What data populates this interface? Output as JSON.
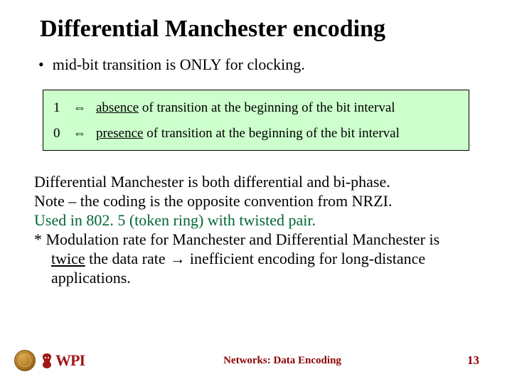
{
  "title": "Differential Manchester encoding",
  "bullet": "mid-bit transition is ONLY for clocking.",
  "rules": [
    {
      "bit": "1",
      "arrow": "⇔",
      "keyword": "absence",
      "rest": " of transition at the beginning of the bit interval"
    },
    {
      "bit": "0",
      "arrow": "⇔",
      "keyword": "presence",
      "rest": " of transition at the beginning of the bit interval"
    }
  ],
  "body": {
    "line1": "Differential Manchester is both differential and bi-phase.",
    "line2": "Note – the coding is the opposite convention from NRZI.",
    "line3": "Used in 802. 5 (token ring) with twisted pair.",
    "line4a": "* Modulation rate for Manchester and Differential Manchester is",
    "line4b_pre": "twice",
    "line4b_arrow": " → ",
    "line4b_post": "inefficient encoding for long-distance",
    "line4b_mid": " the data rate",
    "line4c": "applications."
  },
  "footer": {
    "title": "Networks: Data Encoding",
    "page": "13",
    "brand": "WPI"
  }
}
